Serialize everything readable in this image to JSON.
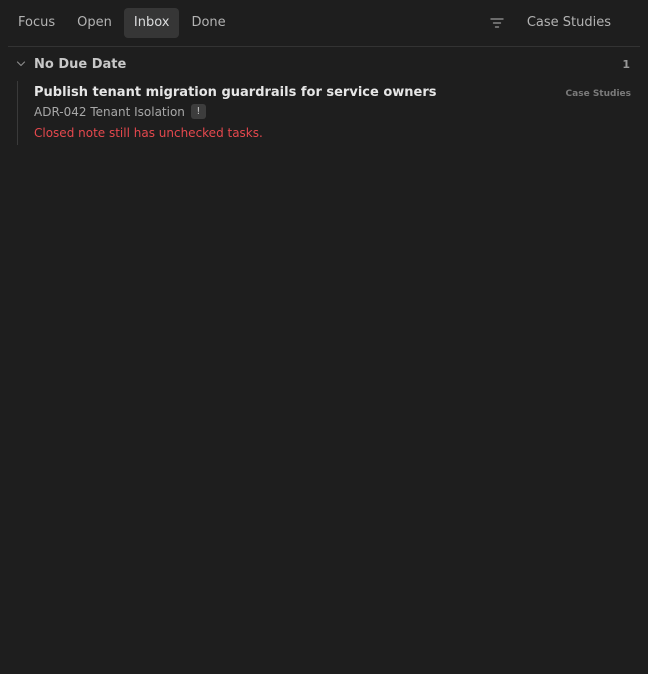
{
  "toolbar": {
    "tabs": [
      {
        "label": "Focus",
        "active": false
      },
      {
        "label": "Open",
        "active": false
      },
      {
        "label": "Inbox",
        "active": true
      },
      {
        "label": "Done",
        "active": false
      }
    ],
    "filter_icon": "filter-icon",
    "source_select": {
      "value": "Case Studies"
    }
  },
  "groups": [
    {
      "title": "No Due Date",
      "count": "1",
      "expanded": true,
      "items": [
        {
          "title": "Publish tenant migration guardrails for service owners",
          "source": "Case Studies",
          "note": "ADR-042 Tenant Isolation",
          "flag": "!",
          "warning": "Closed note still has unchecked tasks."
        }
      ]
    }
  ],
  "colors": {
    "background": "#1e1e1e",
    "active_tab": "#363636",
    "warning": "#e5484d",
    "divider": "#333333"
  }
}
